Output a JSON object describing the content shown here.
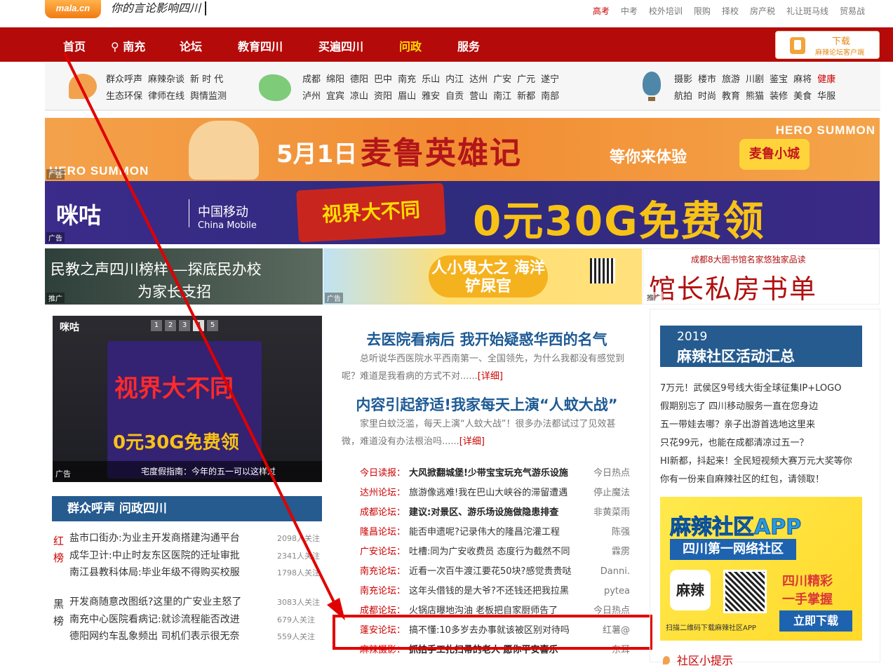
{
  "logo": "mala.cn",
  "slogan": "你的言论影响四川",
  "top_links": [
    {
      "label": "高考",
      "highlight": true
    },
    {
      "label": "中考"
    },
    {
      "label": "校外培训"
    },
    {
      "label": "限购"
    },
    {
      "label": "择校"
    },
    {
      "label": "房产税"
    },
    {
      "label": "礼让斑马线"
    },
    {
      "label": "贸易战"
    }
  ],
  "nav": [
    {
      "label": "首页"
    },
    {
      "label": "南充",
      "icon": "location-pin-icon"
    },
    {
      "label": "论坛"
    },
    {
      "label": "教育四川"
    },
    {
      "label": "买遍四川"
    },
    {
      "label": "问政",
      "highlight": true
    },
    {
      "label": "服务"
    }
  ],
  "download": {
    "title": "下载",
    "subtitle": "麻辣论坛客户端"
  },
  "channels": {
    "group1": [
      [
        "群众呼声",
        "麻辣杂谈",
        "新 时 代"
      ],
      [
        "生态环保",
        "律师在线",
        "舆情监测"
      ]
    ],
    "group2": [
      [
        "成都",
        "绵阳",
        "德阳",
        "巴中",
        "南充",
        "乐山",
        "内江",
        "达州",
        "广安",
        "广元",
        "遂宁"
      ],
      [
        "泸州",
        "宜宾",
        "凉山",
        "资阳",
        "眉山",
        "雅安",
        "自贡",
        "营山",
        "南江",
        "新都",
        "南部"
      ]
    ],
    "group3": [
      [
        "摄影",
        "楼市",
        "旅游",
        "川剧",
        "鉴宝",
        "麻将",
        "健康"
      ],
      [
        "航拍",
        "时尚",
        "教育",
        "熊猫",
        "装修",
        "美食",
        "华服"
      ]
    ],
    "red_items": [
      "健康"
    ]
  },
  "banners": {
    "b1": {
      "hero": "HERO SUMMON",
      "date": "5月1日",
      "main": "麦鲁英雄记",
      "sub": "等你来体验",
      "game": "麦鲁小城",
      "ad": "广告"
    },
    "b2": {
      "brand": "咪咕",
      "cm": "中国移动",
      "cm_en": "China Mobile",
      "tag": "视界大不同",
      "big": "0元30G免费领",
      "ad": "广告"
    },
    "b3": {
      "line1": "民教之声四川榜样 —探底民办校",
      "line2": "为家长支招",
      "ad": "推广"
    },
    "b4": {
      "main": "人小鬼大之 海洋铲屎官",
      "ad": "广告"
    },
    "b5": {
      "small": "成都8大图书馆名家悠独家品读",
      "main": "馆长私房书单",
      "ad": "推广"
    }
  },
  "feature": {
    "brand": "咪咕",
    "dots": [
      "1",
      "2",
      "3",
      "4",
      "5"
    ],
    "active_dot": "4",
    "screen_title": "视界大不同",
    "screen_offer": "0元30G免费领",
    "caption": "宅度假指南：今年的五一可以这样过",
    "ad": "广告"
  },
  "left_section": {
    "title": "群众呼声 问政四川",
    "red_label": "红榜",
    "black_label": "黑榜",
    "red": [
      {
        "title": "盐市口街办:为业主开发商搭建沟通平台",
        "count": "2098人关注"
      },
      {
        "title": "成华卫计:中止时友东区医院的迁址审批",
        "count": "2341人关注"
      },
      {
        "title": "南江县教科体局:毕业年级不得购买校服",
        "count": "1798人关注"
      }
    ],
    "black": [
      {
        "title": "开发商随意改图纸?这里的广安业主怒了",
        "count": "3083人关注"
      },
      {
        "title": "南充中心医院看病记:就诊流程能否改进",
        "count": "679人关注"
      },
      {
        "title": "德阳网约车乱象频出 司机们表示很无奈",
        "count": "559人关注"
      }
    ]
  },
  "middle": {
    "headline1": "去医院看病后 我开始疑惑华西的名气",
    "summary1": "总听说华西医院水平西南第一、全国领先，为什么我都没有感觉到呢？难道是我看病的方式不对......",
    "headline2": "内容引起舒适!我家每天上演“人蚊大战”",
    "summary2": "家里白蚊泛滥，每天上演“人蚊大战”！很多办法都试过了见效甚微，难道没有办法根治吗......",
    "more": "[详细]",
    "news": [
      {
        "src": "今日读报：",
        "title": "大风掀翻城堡!少带宝宝玩充气游乐设施",
        "author": "今日热点",
        "bold": true
      },
      {
        "src": "达州论坛：",
        "title": "旅游像逃难!我在巴山大峡谷的滞留遭遇",
        "author": "停止魔法",
        "bold": false
      },
      {
        "src": "成都论坛：",
        "title": "建议:对景区、游乐场设施做隐患排查",
        "author": "非黄菜雨",
        "bold": true
      },
      {
        "src": "隆昌论坛：",
        "title": "能否申遗呢?记录伟大的隆昌沱灌工程",
        "author": "陈强",
        "bold": false
      },
      {
        "src": "广安论坛：",
        "title": "吐槽:同为广安收费员 态度行为截然不同",
        "author": "霖雳",
        "bold": false
      },
      {
        "src": "南充论坛：",
        "title": "近看一次百牛渡江要花50块?感觉贵贵哒",
        "author": "Danni.",
        "bold": false
      },
      {
        "src": "南充论坛：",
        "title": "这年头借钱的是大爷?不还钱还把我拉黑",
        "author": "pytea",
        "bold": false
      },
      {
        "src": "成都论坛：",
        "title": "火锅店曝地沟油 老板把自家厨师告了",
        "author": "今日热点",
        "bold": false
      },
      {
        "src": "蓬安论坛：",
        "title": "搞不懂:10多岁去办事就该被区别对待吗",
        "author": "红薯@",
        "bold": false
      },
      {
        "src": "麻辣摄影：",
        "title": "抓拍手工扎扫帚的老人 愿你平安喜乐",
        "author": "东耳",
        "bold": true
      }
    ]
  },
  "right": {
    "activity_year": "2019",
    "activity_title": "麻辣社区活动汇总",
    "items": [
      "7万元！武侯区9号线大街全球征集IP+LOGO",
      "假期别忘了 四川移动服务一直在您身边",
      "五一带娃去哪？亲子出游首选地这里来",
      "只花99元，也能在成都清凉过五一？",
      "HI新都，抖起来！全民短视频大赛万元大奖等你",
      "你有一份来自麻辣社区的红包，请领取！"
    ],
    "app_ad": {
      "title": "麻辣社区APP",
      "subtitle": "四川第一网络社区",
      "icon": "麻辣",
      "slogan1": "四川精彩",
      "slogan2": "一手掌握",
      "foot": "扫描二维码下载麻辣社区APP",
      "button": "立即下载"
    },
    "tip": "社区小提示"
  },
  "colors": {
    "nav_bg": "#b50a0a",
    "section_blue": "#255b8f",
    "annotation": "#e00000"
  }
}
